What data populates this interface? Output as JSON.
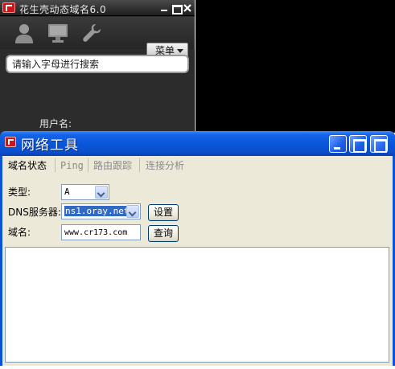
{
  "ddns_window": {
    "title": "花生壳动态域名6.0",
    "menu_label": "菜单",
    "search_placeholder": "请输入字母进行搜索",
    "username_label": "用户名:"
  },
  "tools_window": {
    "title": "网络工具",
    "tabs": [
      {
        "label": "域名状态",
        "active": true
      },
      {
        "label": "Ping",
        "active": false
      },
      {
        "label": "路由跟踪",
        "active": false
      },
      {
        "label": "连接分析",
        "active": false
      }
    ],
    "form": {
      "type_label": "类型:",
      "type_value": "A",
      "dns_label": "DNS服务器:",
      "dns_value": "ns1.oray.net",
      "set_button": "设置",
      "domain_label": "域名:",
      "domain_value": "www.cr173.com",
      "query_button": "查询"
    }
  },
  "icons": [
    "user-icon",
    "monitor-icon",
    "wrench-icon",
    "close-icon",
    "minimize-icon",
    "restore-icon",
    "maximize-icon",
    "chevron-down-icon"
  ],
  "colors": {
    "xp_title_blue": "#0a55d8",
    "ddns_dark": "#2c2c2c",
    "logo_red": "#c8181b",
    "selection_blue": "#316ac5"
  }
}
